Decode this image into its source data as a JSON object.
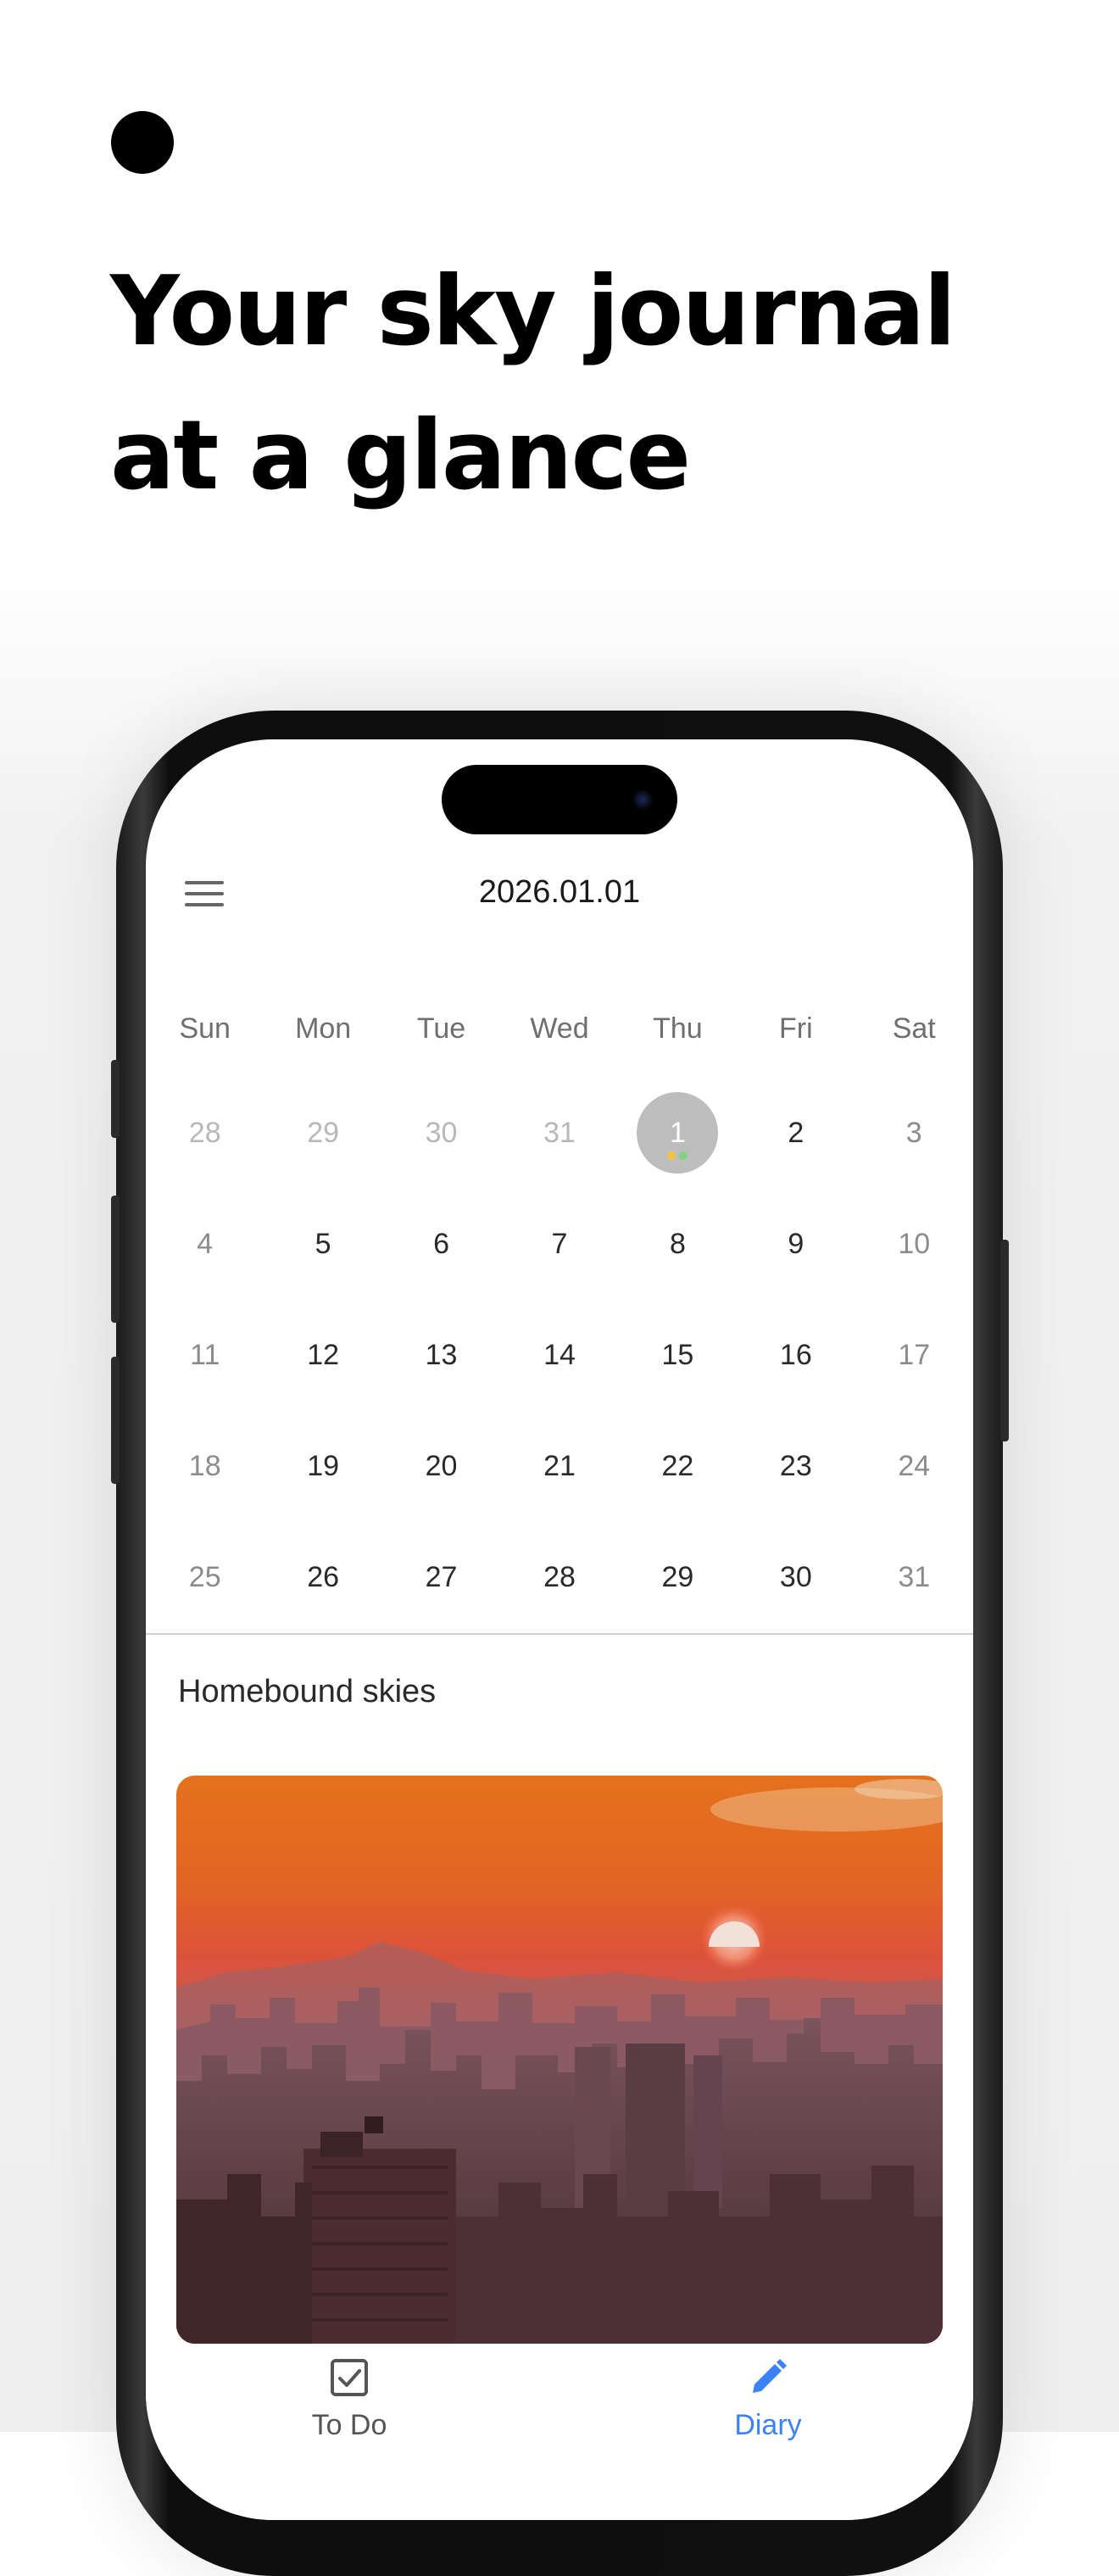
{
  "headline": {
    "line1": "Your sky journal",
    "line2": "at a glance"
  },
  "app": {
    "header": {
      "date": "2026.01.01",
      "menu_icon": "hamburger-menu-icon"
    },
    "calendar": {
      "weekdays": [
        "Sun",
        "Mon",
        "Tue",
        "Wed",
        "Thu",
        "Fri",
        "Sat"
      ],
      "weeks": [
        [
          "28",
          "29",
          "30",
          "31",
          "1",
          "2",
          "3"
        ],
        [
          "4",
          "5",
          "6",
          "7",
          "8",
          "9",
          "10"
        ],
        [
          "11",
          "12",
          "13",
          "14",
          "15",
          "16",
          "17"
        ],
        [
          "18",
          "19",
          "20",
          "21",
          "22",
          "23",
          "24"
        ],
        [
          "25",
          "26",
          "27",
          "28",
          "29",
          "30",
          "31"
        ]
      ],
      "selected_day": "1",
      "selected_day_dot_colors": [
        "#f5c342",
        "#7fd47f"
      ]
    },
    "diary": {
      "title": "Homebound skies"
    },
    "bottom_nav": {
      "items": [
        {
          "label": "To Do",
          "icon": "checkbox-icon",
          "active": false
        },
        {
          "label": "Diary",
          "icon": "pencil-icon",
          "active": true
        }
      ],
      "active_color": "#3b82f6",
      "inactive_color": "#555555"
    }
  }
}
